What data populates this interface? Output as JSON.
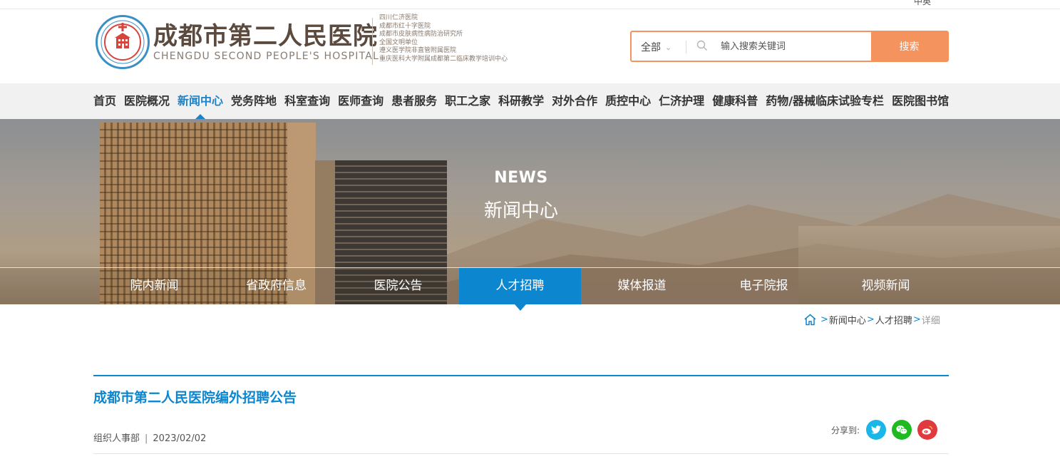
{
  "topbar": {
    "text": "中英"
  },
  "header": {
    "logo_cn": "成都市第二人民医院",
    "logo_en": "CHENGDU SECOND PEOPLE'S HOSPITAL",
    "logo_sub": [
      "四川仁济医院",
      "成都市红十字医院",
      "成都市皮肤病性病防治研究所",
      "全国文明单位",
      "遵义医学院非直管附属医院",
      "重庆医科大学附属成都第二临床教学培训中心"
    ]
  },
  "search": {
    "scope": "全部",
    "placeholder": "输入搜索关键词",
    "button": "搜索",
    "accent": "#f5935e"
  },
  "main_nav": {
    "items": [
      "首页",
      "医院概况",
      "新闻中心",
      "党务阵地",
      "科室查询",
      "医师查询",
      "患者服务",
      "职工之家",
      "科研教学",
      "对外合作",
      "质控中心",
      "仁济护理",
      "健康科普",
      "药物/器械临床试验专栏",
      "医院图书馆"
    ],
    "active": "新闻中心",
    "active_color": "#1d82c8"
  },
  "banner": {
    "title_en": "NEWS",
    "title_cn": "新闻中心"
  },
  "sub_nav": {
    "items": [
      "院内新闻",
      "省政府信息",
      "医院公告",
      "人才招聘",
      "媒体报道",
      "电子院报",
      "视频新闻"
    ],
    "active": "人才招聘",
    "active_color": "#0b86cf"
  },
  "breadcrumb": {
    "items": [
      "新闻中心",
      "人才招聘"
    ],
    "current": "详细"
  },
  "article": {
    "title": "成都市第二人民医院编外招聘公告",
    "author": "组织人事部",
    "separator": "|",
    "date": "2023/02/02",
    "share_label": "分享到:",
    "share_icons": [
      "twitter-icon",
      "wechat-icon",
      "weibo-icon"
    ]
  }
}
